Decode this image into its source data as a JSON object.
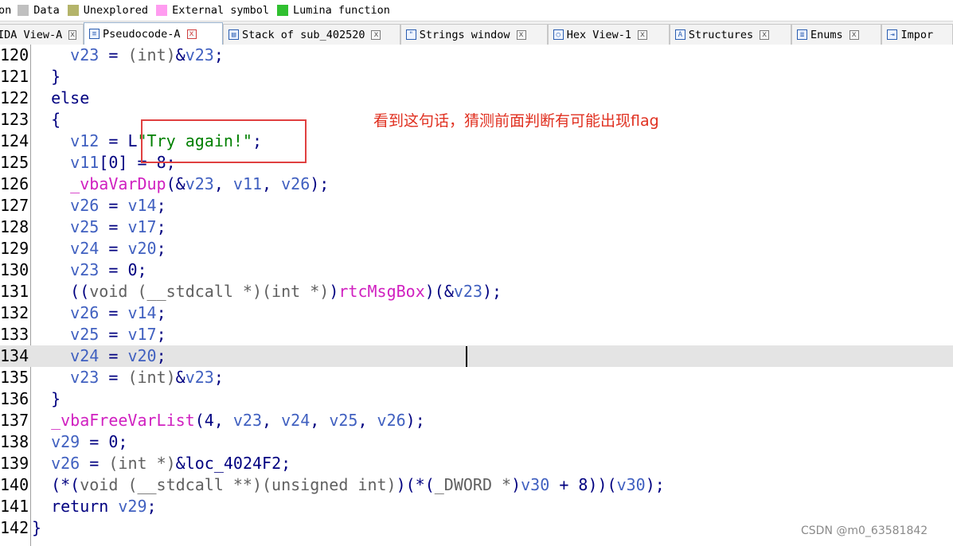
{
  "legend": {
    "lead": "on",
    "items": [
      {
        "label": "Data",
        "color": "#c0c0c0"
      },
      {
        "label": "Unexplored",
        "color": "#b4b46a"
      },
      {
        "label": "External symbol",
        "color": "#ff9cf0"
      },
      {
        "label": "Lumina function",
        "color": "#30c030"
      }
    ]
  },
  "tabs": [
    {
      "label": "IDA View-A",
      "icon": "disassembly-icon",
      "close": "x"
    },
    {
      "label": "Pseudocode-A",
      "icon": "pseudocode-icon",
      "close": "x",
      "active": true
    },
    {
      "label": "Stack of sub_402520",
      "icon": "stack-icon",
      "close": "x"
    },
    {
      "label": "Strings window",
      "icon": "strings-icon",
      "close": "x"
    },
    {
      "label": "Hex View-1",
      "icon": "hex-icon",
      "close": "x"
    },
    {
      "label": "Structures",
      "icon": "structures-icon",
      "close": "x"
    },
    {
      "label": "Enums",
      "icon": "enums-icon",
      "close": "x"
    },
    {
      "label": "Impor",
      "icon": "imports-icon"
    }
  ],
  "code": {
    "line_numbers": [
      "120",
      "121",
      "122",
      "123",
      "124",
      "125",
      "126",
      "127",
      "128",
      "129",
      "130",
      "131",
      "132",
      "133",
      "134",
      "135",
      "136",
      "137",
      "138",
      "139",
      "140",
      "141",
      "142"
    ],
    "highlighted_line": "134"
  },
  "annotation": {
    "note": "看到这句话，猜测前面判断有可能出现flag",
    "box_color": "#e04040"
  },
  "watermark": "CSDN @m0_63581842"
}
